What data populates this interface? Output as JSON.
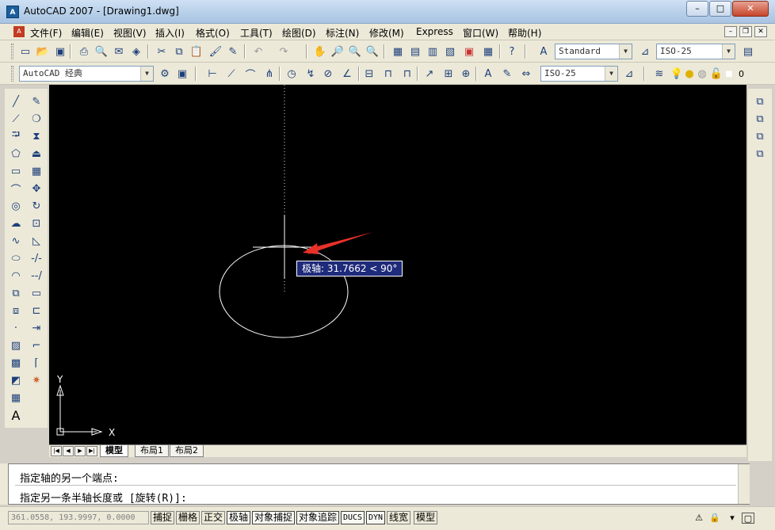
{
  "window": {
    "title": "AutoCAD 2007 - [Drawing1.dwg]",
    "app_icon_label": "A",
    "minimize": "–",
    "maximize": "□",
    "close": "✕"
  },
  "menu": {
    "items": [
      "文件(F)",
      "编辑(E)",
      "视图(V)",
      "插入(I)",
      "格式(O)",
      "工具(T)",
      "绘图(D)",
      "标注(N)",
      "修改(M)",
      "Express",
      "窗口(W)",
      "帮助(H)"
    ],
    "mdi_minimize": "–",
    "mdi_restore": "❐",
    "mdi_close": "✕"
  },
  "toolbars": {
    "text_style": "Standard",
    "dim_style": "ISO-25",
    "workspace": "AutoCAD 经典",
    "dim_style_2": "ISO-25",
    "layer_value": "0"
  },
  "canvas": {
    "tooltip": "极轴: 31.7662 < 90°",
    "ucs_y": "Y",
    "ucs_x": "X"
  },
  "layout_tabs": [
    "模型",
    "布局1",
    "布局2"
  ],
  "command_line": {
    "line1": "指定轴的另一个端点:",
    "line2": "指定另一条半轴长度或 [旋转(R)]:"
  },
  "status": {
    "coordinates": "361.0558, 193.9997, 0.0000",
    "buttons": [
      "捕捉",
      "栅格",
      "正交",
      "极轴",
      "对象捕捉",
      "对象追踪",
      "DUCS",
      "DYN",
      "线宽",
      "模型"
    ],
    "active": [
      "极轴",
      "对象捕捉",
      "对象追踪",
      "DUCS",
      "DYN"
    ]
  },
  "colors": {
    "canvas_bg": "#000000",
    "tooltip_bg": "#1e2a7a",
    "arrow": "#e8312a"
  }
}
